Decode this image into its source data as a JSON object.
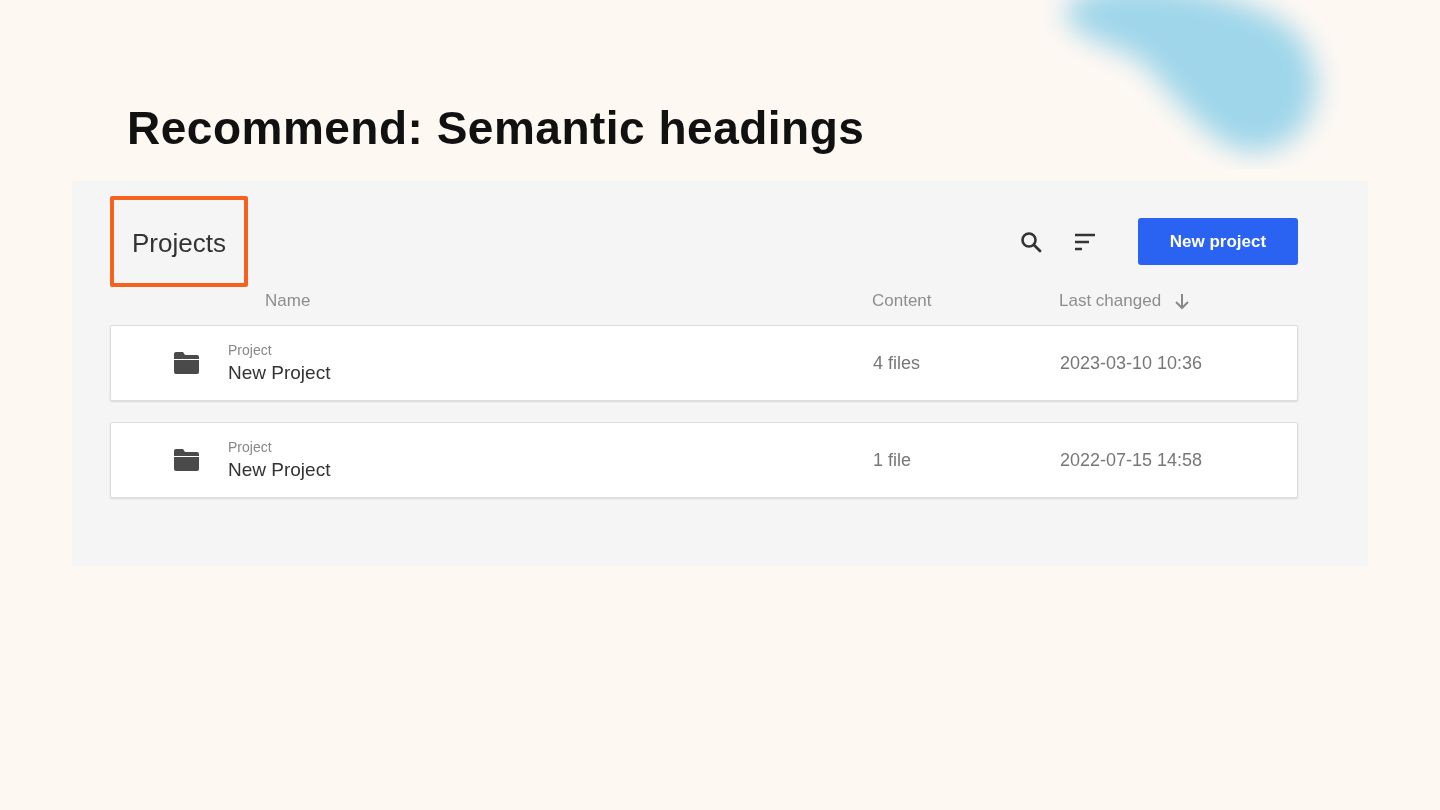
{
  "slide": {
    "title": "Recommend: Semantic headings"
  },
  "panel": {
    "heading": "Projects",
    "highlighted": true,
    "button": "New project",
    "columns": [
      {
        "label": "Name",
        "sorted": false
      },
      {
        "label": "Content",
        "sorted": false
      },
      {
        "label": "Last changed",
        "sorted": true
      }
    ],
    "rows": [
      {
        "type": "Project",
        "name": "New Project",
        "content": "4 files",
        "changed": "2023-03-10 10:36"
      },
      {
        "type": "Project",
        "name": "New Project",
        "content": "1 file",
        "changed": "2022-07-15 14:58"
      }
    ]
  }
}
